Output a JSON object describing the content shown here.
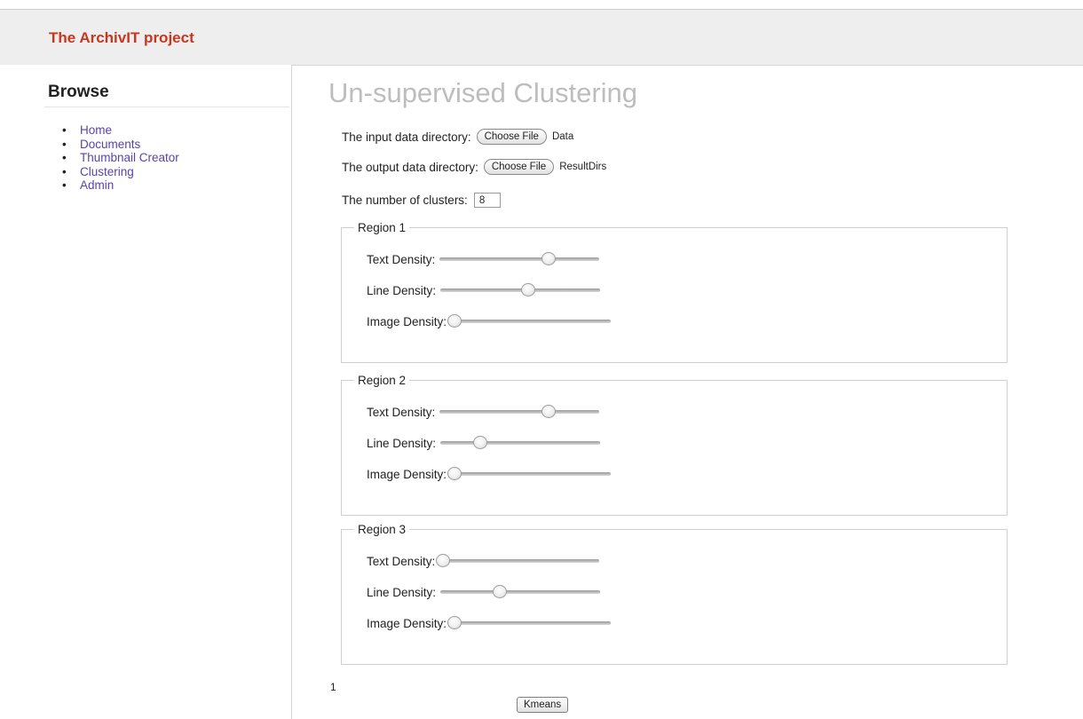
{
  "header": {
    "brand": "The ArchivIT project"
  },
  "sidebar": {
    "heading": "Browse",
    "items": [
      {
        "label": "Home"
      },
      {
        "label": "Documents"
      },
      {
        "label": "Thumbnail Creator"
      },
      {
        "label": "Clustering"
      },
      {
        "label": "Admin"
      }
    ]
  },
  "main": {
    "title": "Un-supervised Clustering",
    "input_dir": {
      "label": "The input data directory:",
      "button": "Choose File",
      "file": "Data"
    },
    "output_dir": {
      "label": "The output data directory:",
      "button": "Choose File",
      "file": "ResultDirs"
    },
    "clusters": {
      "label": "The number of clusters:",
      "value": "8"
    },
    "regions": [
      {
        "legend": "Region 1",
        "sliders": [
          {
            "label": "Text Density:",
            "fraction": 0.68
          },
          {
            "label": "Line Density:",
            "fraction": 0.55
          },
          {
            "label": "Image Density:",
            "fraction": 0.02
          }
        ]
      },
      {
        "legend": "Region 2",
        "sliders": [
          {
            "label": "Text Density:",
            "fraction": 0.68
          },
          {
            "label": "Line Density:",
            "fraction": 0.25
          },
          {
            "label": "Image Density:",
            "fraction": 0.02
          }
        ]
      },
      {
        "legend": "Region 3",
        "sliders": [
          {
            "label": "Text Density:",
            "fraction": 0.02
          },
          {
            "label": "Line Density:",
            "fraction": 0.37
          },
          {
            "label": "Image Density:",
            "fraction": 0.02
          }
        ]
      }
    ],
    "page_number": "1",
    "kmeans_button": "Kmeans"
  }
}
